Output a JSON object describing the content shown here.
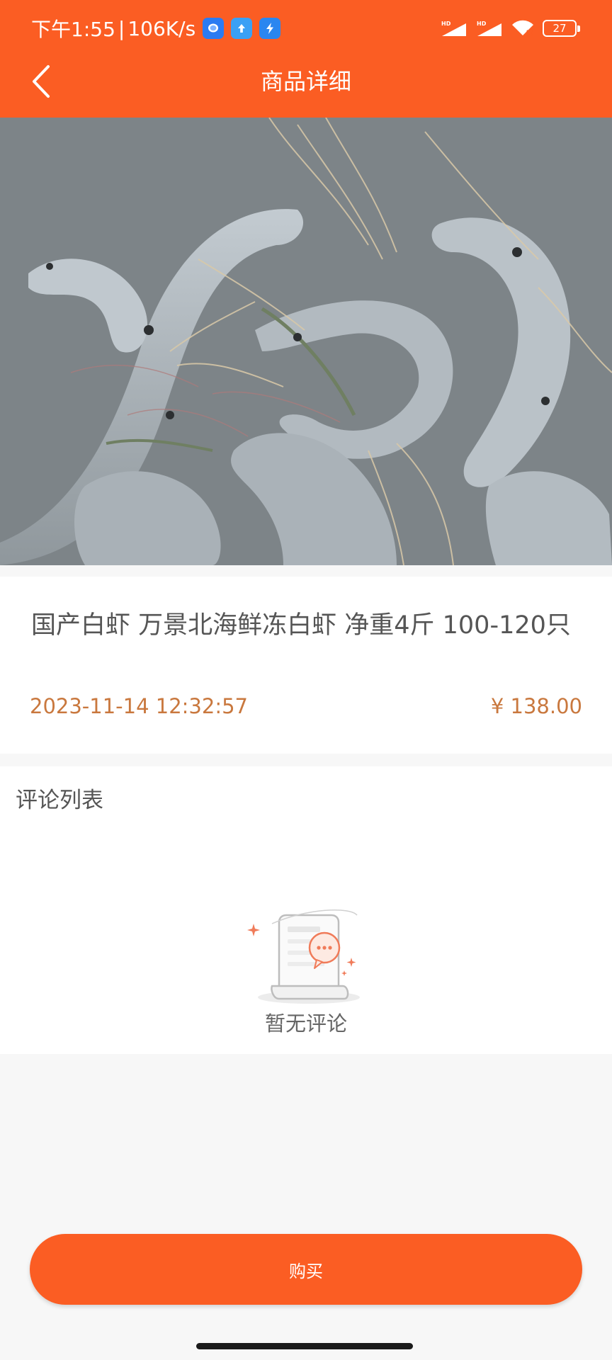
{
  "status_bar": {
    "time": "下午1:55",
    "separator": "|",
    "network_speed": "106K/s",
    "app_icons": [
      "message-app-icon",
      "upload-app-icon",
      "flash-app-icon"
    ],
    "signal_icons": [
      "signal-hd-icon",
      "signal-hd-icon",
      "wifi-icon"
    ],
    "battery": "27"
  },
  "header": {
    "title": "商品详细",
    "back_icon": "chevron-left-icon",
    "background_color": "#fb5d23"
  },
  "product": {
    "image": "shrimp-photo",
    "name": "国产白虾 万景北海鲜冻白虾 净重4斤 100-120只",
    "date": "2023-11-14 12:32:57",
    "price": "¥ 138.00",
    "accent_color": "#c9783e"
  },
  "comments": {
    "title": "评论列表",
    "empty_icon": "empty-comments-icon",
    "empty_text": "暂无评论"
  },
  "actions": {
    "buy_label": "购买"
  }
}
